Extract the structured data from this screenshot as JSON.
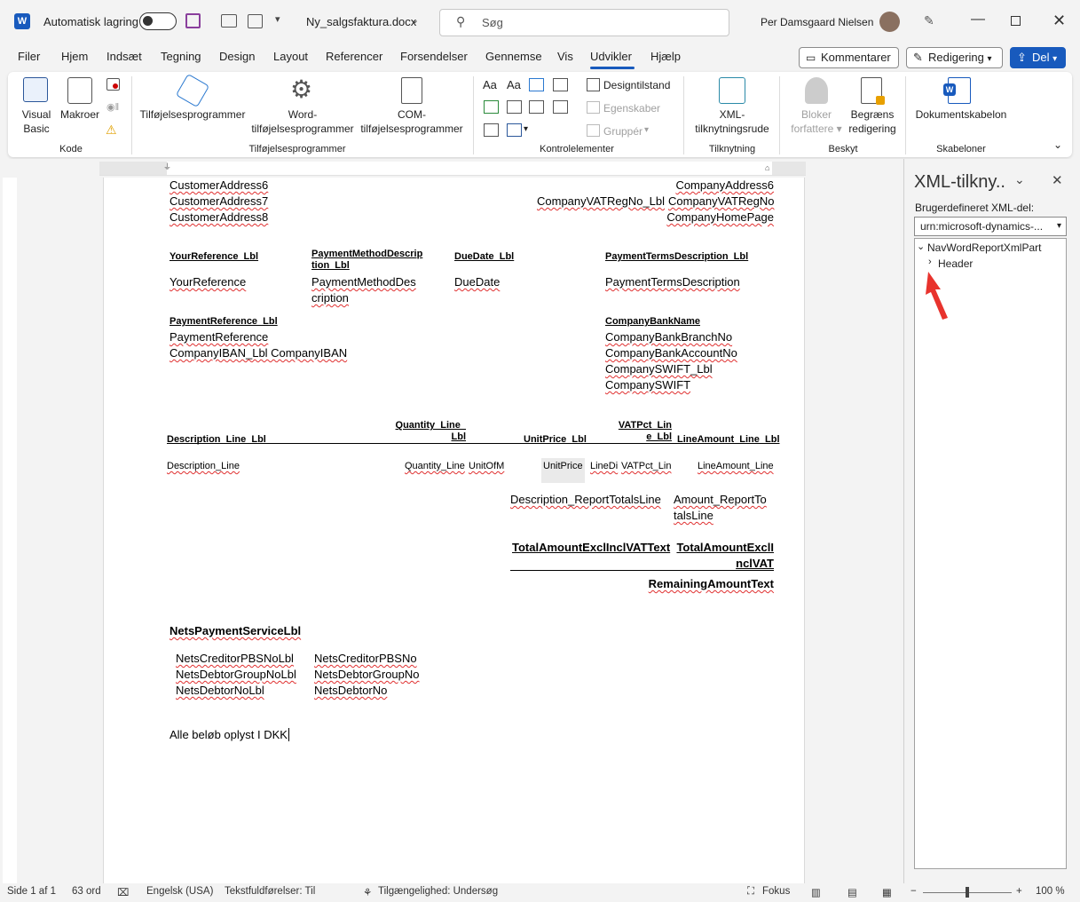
{
  "window": {
    "autosave_label": "Automatisk lagring",
    "filename": "Ny_salgsfaktura.docx",
    "search_placeholder": "Søg",
    "user_name": "Per Damsgaard Nielsen"
  },
  "menu": [
    "Filer",
    "Hjem",
    "Indsæt",
    "Tegning",
    "Design",
    "Layout",
    "Referencer",
    "Forsendelser",
    "Gennemse",
    "Vis",
    "Udvikler",
    "Hjælp"
  ],
  "actions": {
    "comments": "Kommentarer",
    "editing": "Redigering",
    "share": "Del"
  },
  "ribbon": {
    "visual_basic_1": "Visual",
    "visual_basic_2": "Basic",
    "macros": "Makroer",
    "group_code": "Kode",
    "addins": "Tilføjelsesprogrammer",
    "word_addins_1": "Word-",
    "word_addins_2": "tilføjelsesprogrammer",
    "com_addins_1": "COM-",
    "com_addins_2": "tilføjelsesprogrammer",
    "group_addins": "Tilføjelsesprogrammer",
    "design_mode": "Designtilstand",
    "properties": "Egenskaber",
    "group_btn": "Gruppér",
    "group_controls": "Kontrolelementer",
    "xml_pane_1": "XML-",
    "xml_pane_2": "tilknytningsrude",
    "group_mapping": "Tilknytning",
    "block_authors_1": "Bloker",
    "block_authors_2": "forfattere",
    "restrict_1": "Begræns",
    "restrict_2": "redigering",
    "group_protect": "Beskyt",
    "doc_template": "Dokumentskabelon",
    "group_templates": "Skabeloner"
  },
  "document": {
    "cust6": "CustomerAddress6",
    "cust7": "CustomerAddress7",
    "cust8": "CustomerAddress8",
    "comp6": "CompanyAddress6",
    "vat_lbl": "CompanyVATRegNo_Lbl",
    "vat": "CompanyVATRegNo",
    "homepage": "CompanyHomePage",
    "yourref_lbl": "YourReference_Lbl",
    "paymeth_lbl_1": "PaymentMethodDescrip",
    "paymeth_lbl_2": "tion_Lbl",
    "duedate_lbl": "DueDate_Lbl",
    "payterms_lbl": "PaymentTermsDescription_Lbl",
    "yourref": "YourReference",
    "paymeth_1": "PaymentMethodDes",
    "paymeth_2": "cription",
    "duedate": "DueDate",
    "payterms": "PaymentTermsDescription",
    "payref_lbl": "PaymentReference_Lbl",
    "payref": "PaymentReference",
    "iban": "CompanyIBAN_Lbl CompanyIBAN",
    "bankname": "CompanyBankName",
    "bankbranch": "CompanyBankBranchNo",
    "bankacct": "CompanyBankAccountNo",
    "swift_lbl": "CompanySWIFT_Lbl",
    "swift": "CompanySWIFT",
    "h_desc": "Description_Line_Lbl",
    "h_qty_1": "Quantity_Line_",
    "h_qty_2": "Lbl",
    "h_price": "UnitPrice_Lbl",
    "h_vat_1": "VATPct_Lin",
    "h_vat_2": "e_Lbl",
    "h_amt": "LineAmount_Line_Lbl",
    "r_desc": "Description_Line",
    "r_qty": "Quantity_Line",
    "r_uom": "UnitOfM",
    "r_price": "UnitPrice",
    "r_disc": "LineDi",
    "r_vat": "VATPct_Lin",
    "r_amt": "LineAmount_Line",
    "tot_desc": "Description_ReportTotalsLine",
    "tot_amt_1": "Amount_ReportTo",
    "tot_amt_2": "talsLine",
    "excl_text": "TotalAmountExclInclVATText",
    "excl_1": "TotalAmountExclI",
    "excl_2": "nclVAT",
    "remaining": "RemainingAmountText",
    "nets_lbl": "NetsPaymentServiceLbl",
    "nets_c_lbl": "NetsCreditorPBSNoLbl",
    "nets_c": "NetsCreditorPBSNo",
    "nets_g_lbl": "NetsDebtorGroupNoLbl",
    "nets_g": "NetsDebtorGroupNo",
    "nets_d_lbl": "NetsDebtorNoLbl",
    "nets_d": "NetsDebtorNo",
    "footer_note": "Alle beløb oplyst I DKK"
  },
  "xml_pane": {
    "title": "XML-tilkny..",
    "custom_part_label": "Brugerdefineret XML-del:",
    "combo_value": "urn:microsoft-dynamics-...",
    "root_node": "NavWordReportXmlPart",
    "child_node": "Header"
  },
  "status": {
    "page": "Side 1 af 1",
    "words": "63 ord",
    "language": "Engelsk (USA)",
    "text_predictions": "Tekstfuldførelser: Til",
    "accessibility": "Tilgængelighed: Undersøg",
    "focus": "Fokus",
    "zoom": "100 %"
  },
  "colors": {
    "accent": "#185abd",
    "annotation_arrow": "#e8332d"
  }
}
